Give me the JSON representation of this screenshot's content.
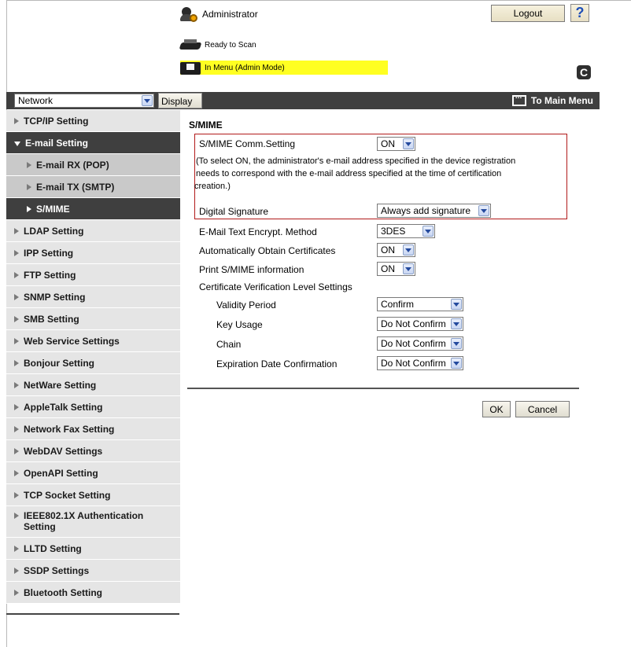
{
  "header": {
    "user_label": "Administrator",
    "logout_label": "Logout",
    "help_label": "?",
    "status_scan": "Ready to Scan",
    "status_menu": "In Menu (Admin Mode)",
    "refresh_label": "C"
  },
  "topbar": {
    "category_value": "Network",
    "display_label": "Display",
    "to_main_label": "To Main Menu"
  },
  "sidebar": {
    "items": [
      {
        "label": "TCP/IP Setting"
      },
      {
        "label": "E-mail Setting"
      },
      {
        "label": "E-mail RX (POP)"
      },
      {
        "label": "E-mail TX (SMTP)"
      },
      {
        "label": "S/MIME"
      },
      {
        "label": "LDAP Setting"
      },
      {
        "label": "IPP Setting"
      },
      {
        "label": "FTP Setting"
      },
      {
        "label": "SNMP Setting"
      },
      {
        "label": "SMB Setting"
      },
      {
        "label": "Web Service Settings"
      },
      {
        "label": "Bonjour Setting"
      },
      {
        "label": "NetWare Setting"
      },
      {
        "label": "AppleTalk Setting"
      },
      {
        "label": "Network Fax Setting"
      },
      {
        "label": "WebDAV Settings"
      },
      {
        "label": "OpenAPI Setting"
      },
      {
        "label": "TCP Socket Setting"
      },
      {
        "label": "IEEE802.1X Authentication Setting"
      },
      {
        "label": "LLTD Setting"
      },
      {
        "label": "SSDP Settings"
      },
      {
        "label": "Bluetooth Setting"
      }
    ]
  },
  "main": {
    "title": "S/MIME",
    "comm_setting_label": "S/MIME Comm.Setting",
    "comm_setting_value": "ON",
    "note_line1": "(To select ON, the administrator's e-mail address specified in the device registration",
    "note_line2": " needs to correspond with the e-mail address specified at the time of certification",
    "note_line3": "creation.)",
    "digital_signature_label": "Digital Signature",
    "digital_signature_value": "Always add signature",
    "encrypt_label": "E-Mail Text Encrypt. Method",
    "encrypt_value": "3DES",
    "auto_cert_label": "Automatically Obtain Certificates",
    "auto_cert_value": "ON",
    "print_info_label": "Print S/MIME information",
    "print_info_value": "ON",
    "cert_level_label": "Certificate Verification Level Settings",
    "validity_label": "Validity Period",
    "validity_value": "Confirm",
    "key_usage_label": "Key Usage",
    "key_usage_value": "Do Not Confirm",
    "chain_label": "Chain",
    "chain_value": "Do Not Confirm",
    "expiration_label": "Expiration Date Confirmation",
    "expiration_value": "Do Not Confirm",
    "ok_label": "OK",
    "cancel_label": "Cancel"
  }
}
